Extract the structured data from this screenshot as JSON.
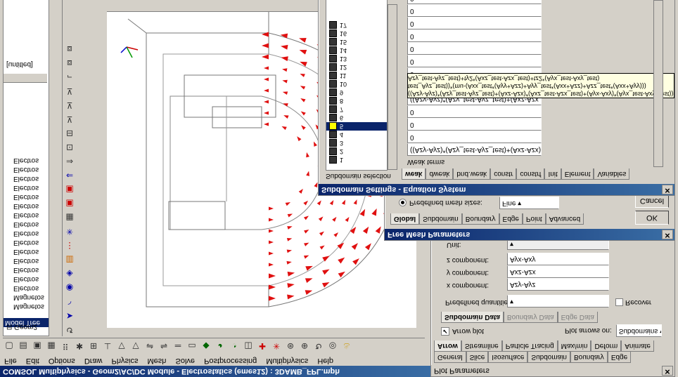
{
  "main_window": {
    "title": "COMSOL Multiphysics - Geom2/AC/DC Module - Electrostatics (emes12) : 3DAMB_FPL.mph",
    "menu": [
      "File",
      "Edit",
      "Options",
      "Draw",
      "Physics",
      "Mesh",
      "Solve",
      "Postprocessing",
      "Multiphysics",
      "Help"
    ]
  },
  "model_tree": {
    "tab_label": "Model Tree",
    "root": "Geom2",
    "items": [
      "Magnetos",
      "Magnetos",
      "Electros",
      "Electros",
      "Electros",
      "Electros",
      "Electros",
      "Electros",
      "Electros",
      "Electros",
      "Electros",
      "Electros",
      "Electros",
      "Electros",
      "Electros",
      "Electros",
      "Electros"
    ],
    "untitled_label": "[untitled]"
  },
  "plot_parameters": {
    "title": "Plot Parameters",
    "tabs_row1": [
      "General",
      "Slice",
      "Isosurface",
      "Subdomain",
      "Boundary",
      "Edge"
    ],
    "tabs_row2": [
      "Arrow",
      "Streamline",
      "Particle Tracing",
      "Max/min",
      "Deform",
      "Animate"
    ],
    "selected_tab": "Arrow",
    "arrow_plot_label": "Arrow plot",
    "plot_arrows_on_label": "Plot arrows on:",
    "plot_arrows_on_value": "Subdomains",
    "data_tabs": [
      "Subdomain Data",
      "Boundary Data",
      "Edge Data"
    ],
    "predefined_label": "Predefined quantities:",
    "recover_label": "Recover",
    "x_label": "x component:",
    "x_value": "Azy-Ayz",
    "y_label": "y component:",
    "y_value": "Axz-Azx",
    "z_label": "z component:",
    "z_value": "Ayx-Axy",
    "unit_label": "Unit:"
  },
  "mesh_parameters": {
    "title": "Free Mesh Parameters",
    "tabs": [
      "Global",
      "Subdomain",
      "Boundary",
      "Edge",
      "Point",
      "Advanced"
    ],
    "predefined_label": "Predefined mesh sizes:",
    "predefined_value": "Fine",
    "ok_label": "OK",
    "cancel_label": "Cancel"
  },
  "subdomain_settings": {
    "title": "Subdomain Settings - Equation System",
    "selection_label": "Subdomain selection",
    "subdomains": [
      "1",
      "2",
      "3",
      "4",
      "5",
      "6",
      "7",
      "8",
      "9",
      "10",
      "11",
      "12",
      "13",
      "14",
      "15",
      "16",
      "17"
    ],
    "selected": "5",
    "tabs": [
      "weak",
      "dweak",
      "bnd.weak",
      "constr",
      "constrf",
      "Init",
      "Element",
      "Variables"
    ],
    "weak_terms_label": "Weak terms",
    "field_first": "((Azy-Ayz)*(Azy_test-Ayz_test)+(Axz-Azx)*(Axz",
    "field_row5": "((Azy-Ayz)*(Azy_test-Ayz_test)+(Axz-Azx",
    "tooltip_line1": "((Azy-Ayz)*(Azy_test-Ayz_test)+(Axz-Azx)*(Axz_test-Azx_test)+(Ayx-Axy)*(Ayx_test-Axy_test))+1x2*(A",
    "tooltip_line2": "test_Ayz_test))*(mu-(Axx_test*(Ayy+Azz)+Ayy_test*(Axx+Azz)+Azz_test*(Axx+Ayy)))",
    "tooltip_line3": "Azy_test-Ayz_test)+ty2*(Axz_test-Azx_test)+tz2*(Ayx_test-Axy_test)",
    "zero_value": "0"
  }
}
